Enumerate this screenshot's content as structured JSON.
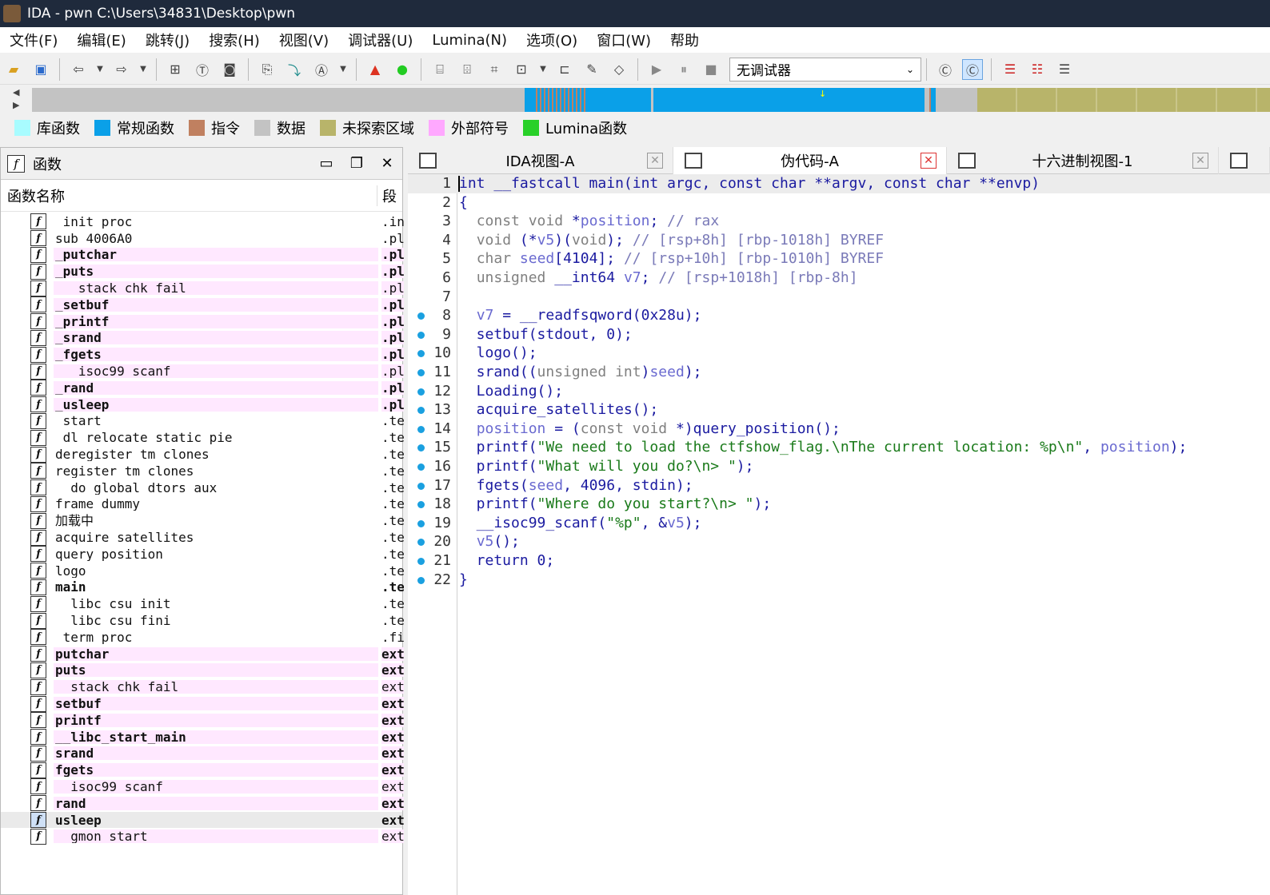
{
  "window": {
    "title": "IDA - pwn C:\\Users\\34831\\Desktop\\pwn"
  },
  "menu": [
    "文件(F)",
    "编辑(E)",
    "跳转(J)",
    "搜索(H)",
    "视图(V)",
    "调试器(U)",
    "Lumina(N)",
    "选项(O)",
    "窗口(W)",
    "帮助"
  ],
  "toolbar": {
    "debugger_select": "无调试器"
  },
  "navbar": {
    "colors": {
      "bg": "#c3c3c3",
      "regular": "#0aa0e8",
      "instruction": "#c08060",
      "unexplored": "#b8b46a"
    }
  },
  "legend": [
    {
      "label": "库函数",
      "color": "#a8fcff"
    },
    {
      "label": "常规函数",
      "color": "#0aa0e8"
    },
    {
      "label": "指令",
      "color": "#c08060"
    },
    {
      "label": "数据",
      "color": "#c3c3c3"
    },
    {
      "label": "未探索区域",
      "color": "#b8b46a"
    },
    {
      "label": "外部符号",
      "color": "#ffa8ff"
    },
    {
      "label": "Lumina函数",
      "color": "#28d028"
    }
  ],
  "functions_panel": {
    "title": "函数",
    "col_name": "函数名称",
    "col_segment": "段",
    "rows": [
      {
        "name": "_init_proc",
        "seg": ".in",
        "style": ""
      },
      {
        "name": "sub_4006A0",
        "seg": ".pl",
        "style": ""
      },
      {
        "name": "_putchar",
        "seg": ".pl",
        "style": "pink bold"
      },
      {
        "name": "_puts",
        "seg": ".pl",
        "style": "pink bold"
      },
      {
        "name": "___stack_chk_fail",
        "seg": ".pl",
        "style": "pink"
      },
      {
        "name": "_setbuf",
        "seg": ".pl",
        "style": "pink bold"
      },
      {
        "name": "_printf",
        "seg": ".pl",
        "style": "pink bold"
      },
      {
        "name": "_srand",
        "seg": ".pl",
        "style": "pink bold"
      },
      {
        "name": "_fgets",
        "seg": ".pl",
        "style": "pink bold"
      },
      {
        "name": "___isoc99_scanf",
        "seg": ".pl",
        "style": "pink"
      },
      {
        "name": "_rand",
        "seg": ".pl",
        "style": "pink bold"
      },
      {
        "name": "_usleep",
        "seg": ".pl",
        "style": "pink bold"
      },
      {
        "name": "_start",
        "seg": ".te",
        "style": ""
      },
      {
        "name": "_dl_relocate_static_pie",
        "seg": ".te",
        "style": ""
      },
      {
        "name": "deregister_tm_clones",
        "seg": ".te",
        "style": ""
      },
      {
        "name": "register_tm_clones",
        "seg": ".te",
        "style": ""
      },
      {
        "name": "__do_global_dtors_aux",
        "seg": ".te",
        "style": ""
      },
      {
        "name": "frame_dummy",
        "seg": ".te",
        "style": ""
      },
      {
        "name": "加载中",
        "seg": ".te",
        "style": ""
      },
      {
        "name": "acquire_satellites",
        "seg": ".te",
        "style": ""
      },
      {
        "name": "query_position",
        "seg": ".te",
        "style": ""
      },
      {
        "name": "logo",
        "seg": ".te",
        "style": ""
      },
      {
        "name": "main",
        "seg": ".te",
        "style": "bold"
      },
      {
        "name": "__libc_csu_init",
        "seg": ".te",
        "style": ""
      },
      {
        "name": "__libc_csu_fini",
        "seg": ".te",
        "style": ""
      },
      {
        "name": "_term_proc",
        "seg": ".fi",
        "style": ""
      },
      {
        "name": "putchar",
        "seg": "ext",
        "style": "pink bold"
      },
      {
        "name": "puts",
        "seg": "ext",
        "style": "pink bold"
      },
      {
        "name": "__stack_chk_fail",
        "seg": "ext",
        "style": "pink"
      },
      {
        "name": "setbuf",
        "seg": "ext",
        "style": "pink bold"
      },
      {
        "name": "printf",
        "seg": "ext",
        "style": "pink bold"
      },
      {
        "name": "__libc_start_main",
        "seg": "ext",
        "style": "pink bold"
      },
      {
        "name": "srand",
        "seg": "ext",
        "style": "pink bold"
      },
      {
        "name": "fgets",
        "seg": "ext",
        "style": "pink bold"
      },
      {
        "name": "__isoc99_scanf",
        "seg": "ext",
        "style": "pink"
      },
      {
        "name": "rand",
        "seg": "ext",
        "style": "pink bold"
      },
      {
        "name": "usleep",
        "seg": "ext",
        "style": "bold sel"
      },
      {
        "name": "__gmon_start__",
        "seg": "ext",
        "style": "pink"
      }
    ]
  },
  "tabs": [
    {
      "label": "IDA视图-A",
      "active": false
    },
    {
      "label": "伪代码-A",
      "active": true
    },
    {
      "label": "十六进制视图-1",
      "active": false
    }
  ],
  "code_lines": [
    {
      "n": "1",
      "dot": false,
      "text": "int __fastcall main(int argc, const char **argv, const char **envp)"
    },
    {
      "n": "2",
      "dot": false,
      "text": "{"
    },
    {
      "n": "3",
      "dot": false,
      "text": "  const void *position; // rax"
    },
    {
      "n": "4",
      "dot": false,
      "text": "  void (*v5)(void); // [rsp+8h] [rbp-1018h] BYREF"
    },
    {
      "n": "5",
      "dot": false,
      "text": "  char seed[4104]; // [rsp+10h] [rbp-1010h] BYREF"
    },
    {
      "n": "6",
      "dot": false,
      "text": "  unsigned __int64 v7; // [rsp+1018h] [rbp-8h]"
    },
    {
      "n": "7",
      "dot": false,
      "text": ""
    },
    {
      "n": "8",
      "dot": true,
      "text": "  v7 = __readfsqword(0x28u);"
    },
    {
      "n": "9",
      "dot": true,
      "text": "  setbuf(stdout, 0);"
    },
    {
      "n": "10",
      "dot": true,
      "text": "  logo();"
    },
    {
      "n": "11",
      "dot": true,
      "text": "  srand((unsigned int)seed);"
    },
    {
      "n": "12",
      "dot": true,
      "text": "  Loading();"
    },
    {
      "n": "13",
      "dot": true,
      "text": "  acquire_satellites();"
    },
    {
      "n": "14",
      "dot": true,
      "text": "  position = (const void *)query_position();"
    },
    {
      "n": "15",
      "dot": true,
      "text": "  printf(\"We need to load the ctfshow_flag.\\nThe current location: %p\\n\", position);"
    },
    {
      "n": "16",
      "dot": true,
      "text": "  printf(\"What will you do?\\n> \");"
    },
    {
      "n": "17",
      "dot": true,
      "text": "  fgets(seed, 4096, stdin);"
    },
    {
      "n": "18",
      "dot": true,
      "text": "  printf(\"Where do you start?\\n> \");"
    },
    {
      "n": "19",
      "dot": true,
      "text": "  __isoc99_scanf(\"%p\", &v5);"
    },
    {
      "n": "20",
      "dot": true,
      "text": "  v5();"
    },
    {
      "n": "21",
      "dot": true,
      "text": "  return 0;"
    },
    {
      "n": "22",
      "dot": true,
      "text": "}"
    }
  ]
}
